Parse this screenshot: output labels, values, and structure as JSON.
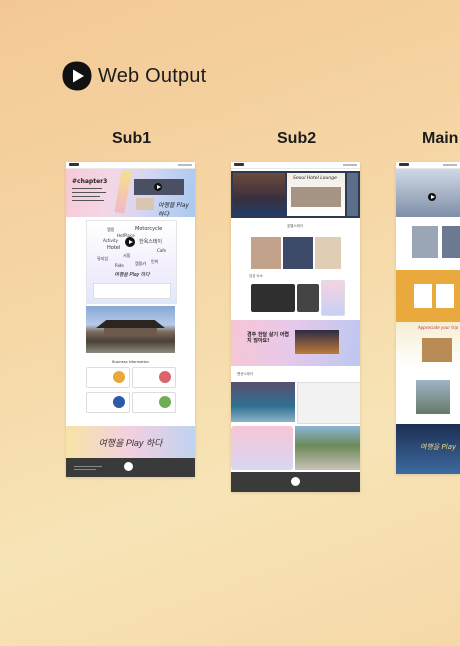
{
  "header": {
    "title": "Web Output",
    "logo_icon": "play-logo-icon"
  },
  "columns": [
    {
      "label": "Sub1"
    },
    {
      "label": "Sub2"
    },
    {
      "label": "Main"
    }
  ],
  "sub1": {
    "hero_tag": "#chapter3",
    "hero_script": "여행을 Play 하다",
    "keyword_words": [
      "캠핑",
      "Motorcycle",
      "HotPlace",
      "Activity",
      "한옥스테이",
      "Hotel",
      "Cafe",
      "뮤지엄",
      "서핑",
      "Ride",
      "캠핑카",
      "민박"
    ],
    "section_title": "Business Information",
    "banner_text": "여행을 Play 하다"
  },
  "sub2": {
    "hero_script": "Seoul Hotel Lounge",
    "section_a": "호텔스테이",
    "section_b": "감성 숙소",
    "promo_text": "경주 한달 살기 어렵지 않아요!",
    "section_c": "펜션스테이"
  },
  "main": {
    "promo_script": "Appreciate your trip",
    "banner_text": "여행을 Play"
  },
  "colors": {
    "accent": "#e9a93c",
    "dark": "#3a3a3a",
    "background": "#f6d8a8"
  }
}
